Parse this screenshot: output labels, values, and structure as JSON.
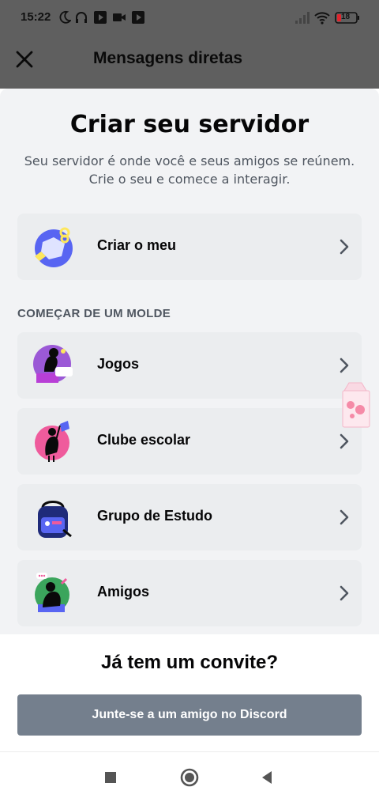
{
  "status_bar": {
    "time": "15:22",
    "battery": "18",
    "icons": [
      "moon-icon",
      "headphones-icon",
      "play-icon",
      "video-icon",
      "play-icon",
      "signal-icon",
      "wifi-icon",
      "battery-icon"
    ]
  },
  "header": {
    "title": "Mensagens diretas",
    "close_icon": "close-icon"
  },
  "sheet": {
    "title": "Criar seu servidor",
    "subtitle_line1": "Seu servidor é onde você e seus amigos se reúnem.",
    "subtitle_line2": "Crie o seu e comece a interagir.",
    "create_own": {
      "label": "Criar o meu",
      "icon": "globe-icon"
    },
    "section_label": "COMEÇAR DE UM MOLDE",
    "templates": [
      {
        "label": "Jogos",
        "icon": "gaming-icon"
      },
      {
        "label": "Clube escolar",
        "icon": "school-club-icon"
      },
      {
        "label": "Grupo de Estudo",
        "icon": "backpack-icon"
      },
      {
        "label": "Amigos",
        "icon": "friends-icon"
      }
    ]
  },
  "invite": {
    "title": "Já tem um convite?",
    "button_label": "Junte-se a um amigo no Discord"
  },
  "colors": {
    "overlay": "#5f5f5f",
    "sheet_bg": "#f2f3f5",
    "card_bg": "#ebedef",
    "button_bg": "#747f8d"
  },
  "navbar": {
    "icons": [
      "recents-icon",
      "home-icon",
      "back-icon"
    ]
  }
}
